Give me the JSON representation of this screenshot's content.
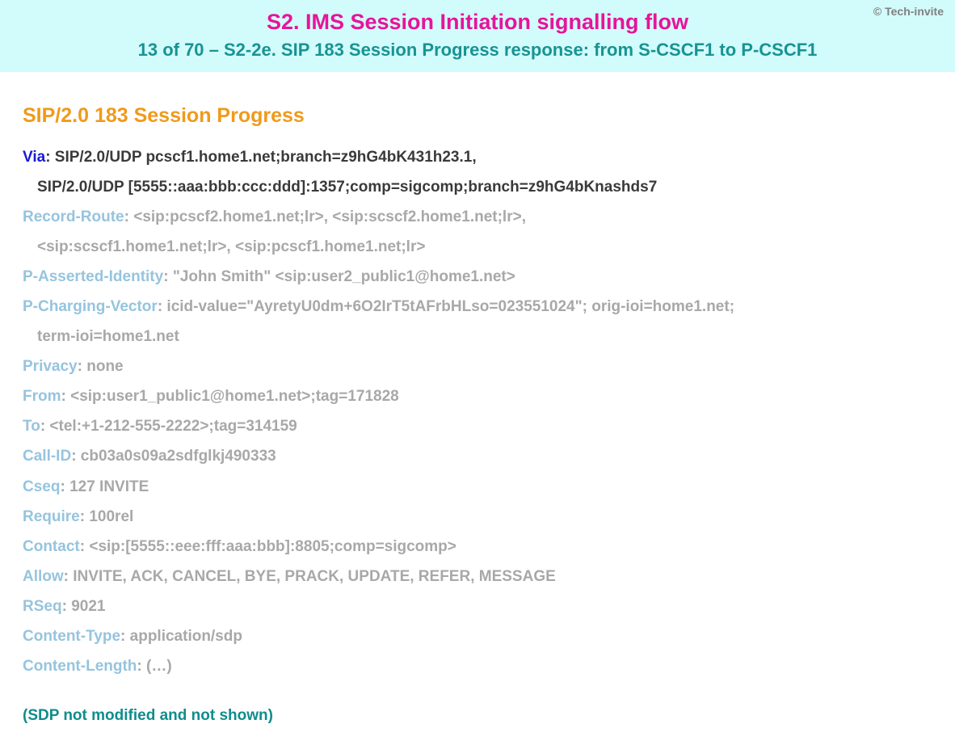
{
  "header": {
    "copyright": "© Tech-invite",
    "title_main": "S2. IMS Session Initiation signalling flow",
    "title_sub": "13 of 70 – S2-2e. SIP 183 Session Progress response: from S-CSCF1 to P-CSCF1"
  },
  "status_line": "SIP/2.0 183 Session Progress",
  "via": {
    "name": "Via",
    "value_line1": "SIP/2.0/UDP pcscf1.home1.net;branch=z9hG4bK431h23.1,",
    "value_line2": "SIP/2.0/UDP [5555::aaa:bbb:ccc:ddd]:1357;comp=sigcomp;branch=z9hG4bKnashds7"
  },
  "record_route": {
    "name": "Record-Route",
    "value_line1": "<sip:pcscf2.home1.net;lr>, <sip:scscf2.home1.net;lr>,",
    "value_line2": "<sip:scscf1.home1.net;lr>, <sip:pcscf1.home1.net;lr>"
  },
  "p_asserted_identity": {
    "name": "P-Asserted-Identity",
    "value": "\"John Smith\" <sip:user2_public1@home1.net>"
  },
  "p_charging_vector": {
    "name": "P-Charging-Vector",
    "value_line1": "icid-value=\"AyretyU0dm+6O2IrT5tAFrbHLso=023551024\"; orig-ioi=home1.net;",
    "value_line2": "term-ioi=home1.net"
  },
  "privacy": {
    "name": "Privacy",
    "value": "none"
  },
  "from": {
    "name": "From",
    "value": "<sip:user1_public1@home1.net>;tag=171828"
  },
  "to": {
    "name": "To",
    "value": "<tel:+1-212-555-2222>;tag=314159"
  },
  "call_id": {
    "name": "Call-ID",
    "value": "cb03a0s09a2sdfglkj490333"
  },
  "cseq": {
    "name": "Cseq",
    "value": "127 INVITE"
  },
  "require": {
    "name": "Require",
    "value": "100rel"
  },
  "contact": {
    "name": "Contact",
    "value": "<sip:[5555::eee:fff:aaa:bbb]:8805;comp=sigcomp>"
  },
  "allow": {
    "name": "Allow",
    "value": "INVITE, ACK, CANCEL, BYE, PRACK, UPDATE, REFER, MESSAGE"
  },
  "rseq": {
    "name": "RSeq",
    "value": "9021"
  },
  "content_type": {
    "name": "Content-Type",
    "value": "application/sdp"
  },
  "content_length": {
    "name": "Content-Length",
    "value": "(…)"
  },
  "sdp_note": "(SDP not modified and not shown)"
}
